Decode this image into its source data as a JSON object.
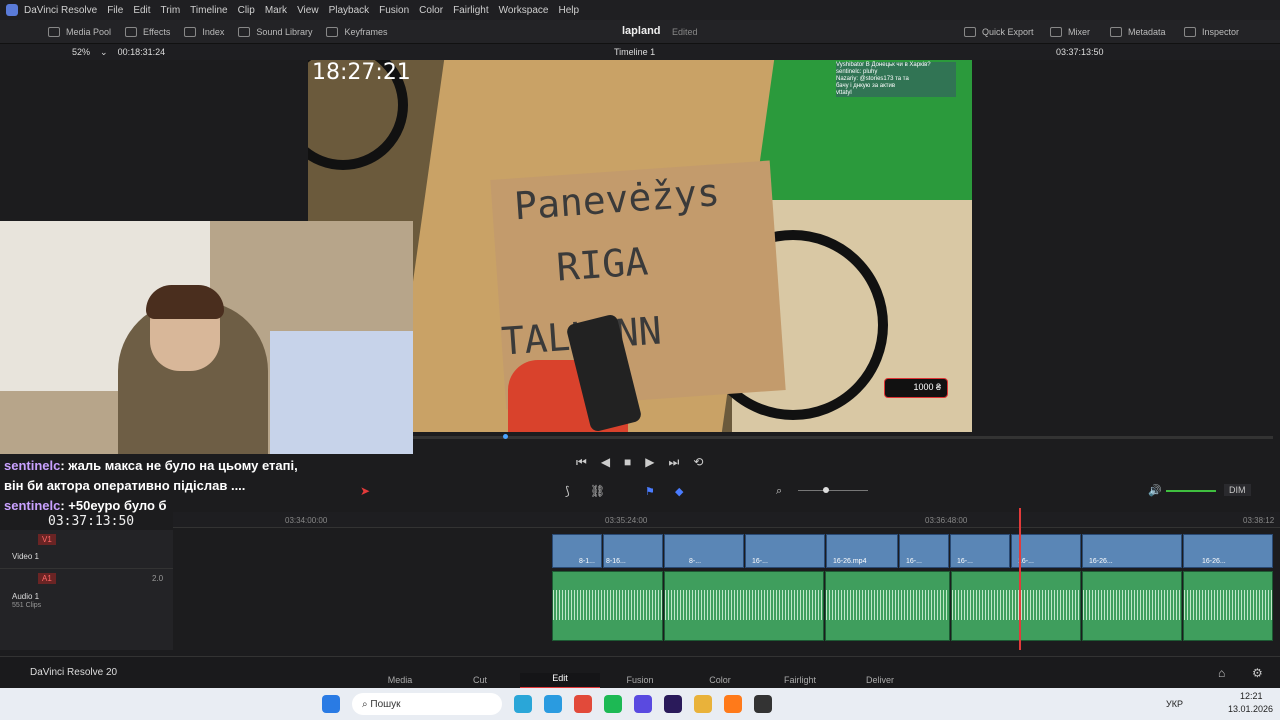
{
  "menu": {
    "items": [
      "DaVinci Resolve",
      "File",
      "Edit",
      "Trim",
      "Timeline",
      "Clip",
      "Mark",
      "View",
      "Playback",
      "Fusion",
      "Color",
      "Fairlight",
      "Workspace",
      "Help"
    ]
  },
  "toolbar": {
    "media_pool": "Media Pool",
    "effects": "Effects",
    "index": "Index",
    "sound_library": "Sound Library",
    "keyframes": "Keyframes",
    "project": "lapland",
    "status": "Edited",
    "quick_export": "Quick Export",
    "mixer": "Mixer",
    "metadata": "Metadata",
    "inspector": "Inspector"
  },
  "viewer_bar": {
    "zoom": "52%",
    "source_tc": "00:18:31:24",
    "timeline": "Timeline 1",
    "record_tc": "03:37:13:50"
  },
  "frame": {
    "clock": "18:27:21",
    "sign_lines": [
      "Panevėžys",
      "RIGA",
      "TALLINN"
    ],
    "badge": "1000 ₴",
    "chat_lines": [
      "Vyshibator В Донецьк чи в Харків?",
      "sentinelc: pluhy",
      "Nazariy: @stories173 та та",
      "бачу і днкую за актив",
      "vttatyl"
    ]
  },
  "overlay_chat": [
    {
      "user": "sentinelc",
      "text": ": жаль макса не було на цьому етапі,"
    },
    {
      "user": "",
      "text": "він би актора оперативно підіслав ...."
    },
    {
      "user": "sentinelc",
      "text": ": +50еуро було б"
    }
  ],
  "timeline": {
    "timecode": "03:37:13:50",
    "ruler": [
      "03:34:00:00",
      "03:35:24:00",
      "03:36:48:00",
      "03:38:12"
    ],
    "dim": "DIM",
    "v1": {
      "tag": "V1",
      "name": "Video 1"
    },
    "a1": {
      "tag": "A1",
      "name": "Audio 1",
      "clips": "551 Clips",
      "level": "2.0"
    },
    "clip_labels": [
      "8-1...",
      "8-16...",
      "8-...",
      "16-...",
      "16-26.mp4",
      "16-...",
      "16-...",
      "16-...",
      "16-26...",
      "16-26..."
    ]
  },
  "pages": {
    "brand": "DaVinci Resolve 20",
    "items": [
      "Media",
      "Cut",
      "Edit",
      "Fusion",
      "Color",
      "Fairlight",
      "Deliver"
    ],
    "active": "Edit"
  },
  "taskbar": {
    "search": "Пошук",
    "lang": "УКР",
    "time": "12:21",
    "date": "13.01.2026"
  }
}
